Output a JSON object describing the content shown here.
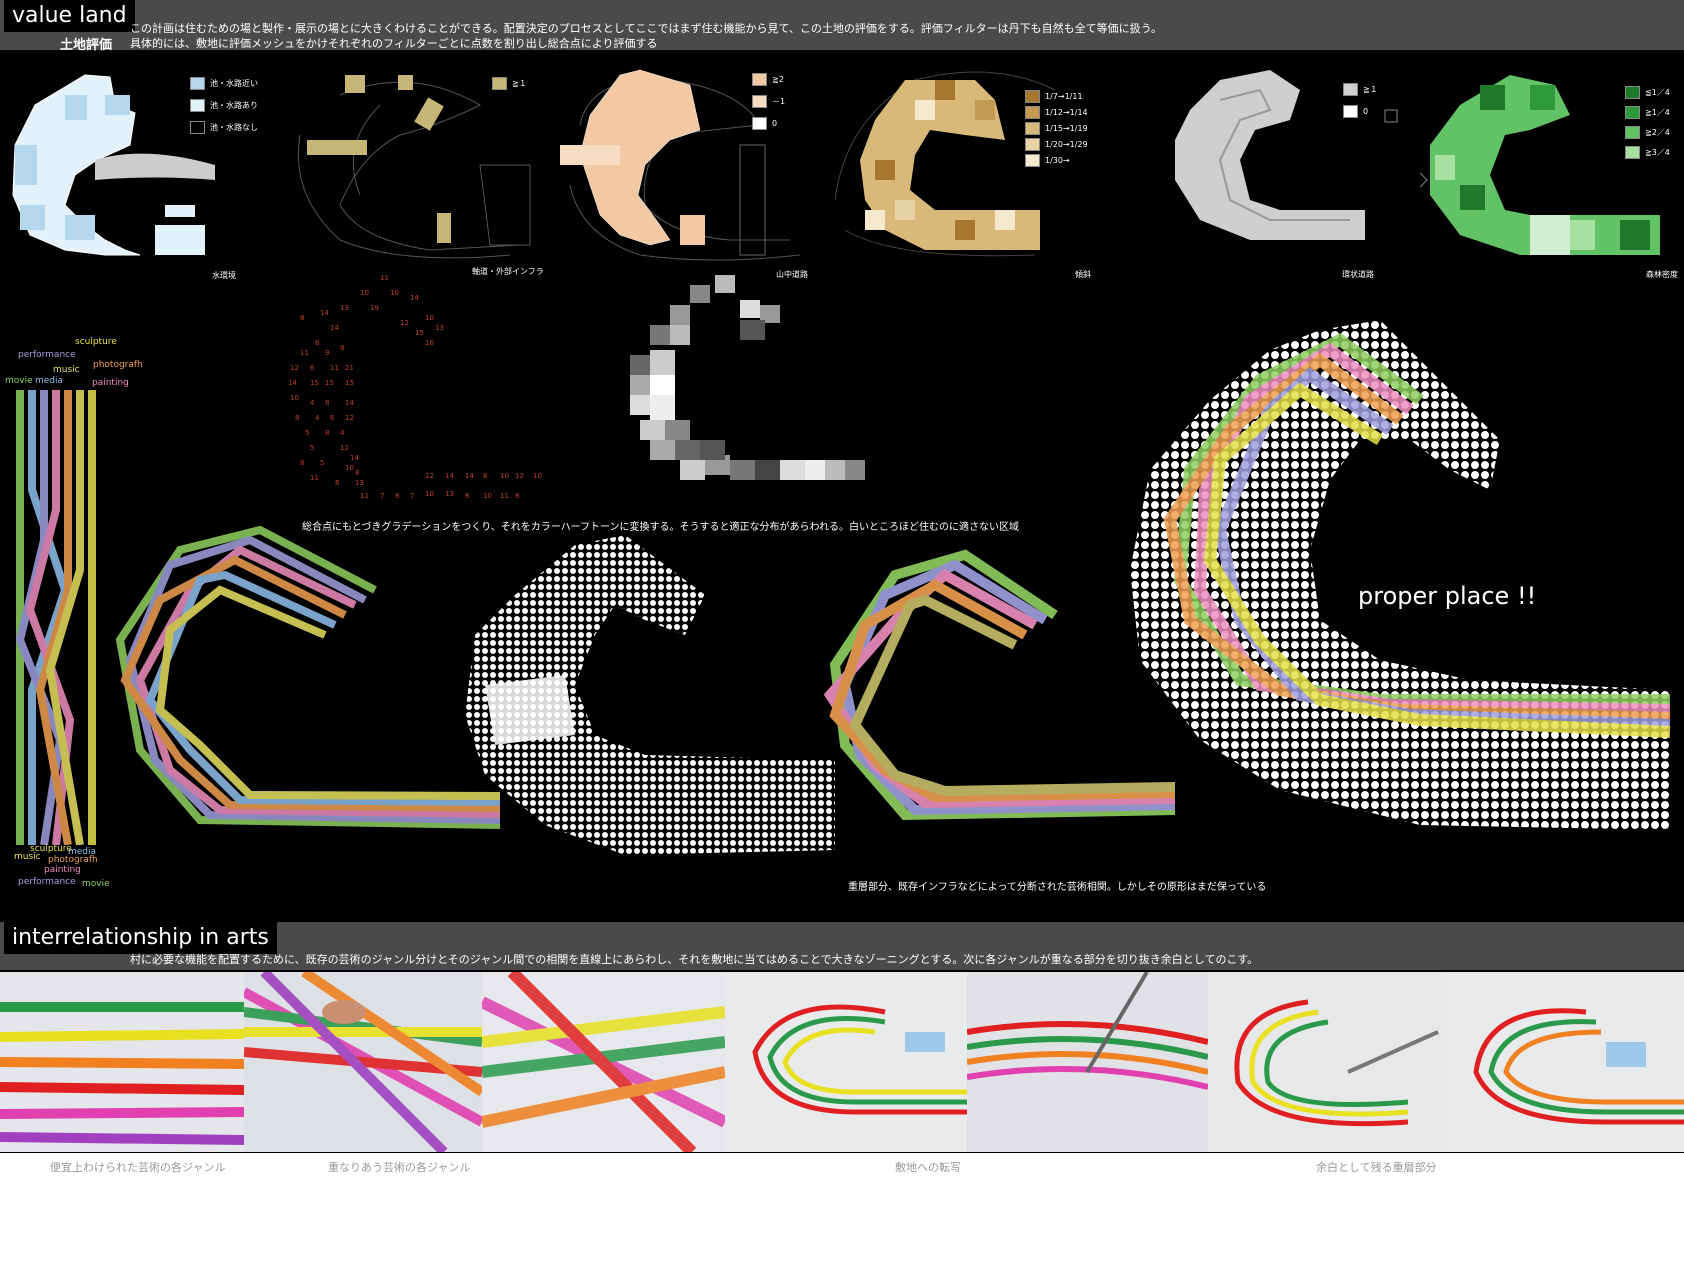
{
  "header": {
    "title": "value land",
    "subtitle": "土地評価",
    "desc1": "この計画は住むための場と製作・展示の場とに大きくわけることができる。配置決定のプロセスとしてここではまず住む機能から見て、この土地の評価をする。評価フィルターは丹下も自然も全て等価に扱う。",
    "desc2": "具体的には、敷地に評価メッシュをかけそれぞれのフィルターごとに点数を割り出し総合点により評価する"
  },
  "maps": [
    {
      "caption": "水環境",
      "legend": [
        {
          "label": "池・水路近い",
          "color": "#b6d8ef"
        },
        {
          "label": "池・水路あり",
          "color": "#e2f1fa"
        },
        {
          "label": "池・水路なし",
          "color": "#000000"
        }
      ]
    },
    {
      "caption": "軸道・外部インフラ",
      "legend": [
        {
          "label": "≧１",
          "color": "#c8b677"
        }
      ]
    },
    {
      "caption": "山中道路",
      "legend": [
        {
          "label": "≧2",
          "color": "#f2c9a2"
        },
        {
          "label": "－1",
          "color": "#f6dcc3"
        },
        {
          "label": "0",
          "color": "#ffffff"
        }
      ]
    },
    {
      "caption": "傾斜",
      "legend": [
        {
          "label": "1/7→1/11",
          "color": "#a8772f"
        },
        {
          "label": "1/12→1/14",
          "color": "#c49a53"
        },
        {
          "label": "1/15→1/19",
          "color": "#d9b97a"
        },
        {
          "label": "1/20→1/29",
          "color": "#e8d3a4"
        },
        {
          "label": "1/30→",
          "color": "#f5ead0"
        }
      ]
    },
    {
      "caption": "環状道路",
      "legend": [
        {
          "label": "≧１",
          "color": "#cfcfcf"
        },
        {
          "label": "0",
          "color": "#ffffff"
        }
      ]
    },
    {
      "caption": "森林密度",
      "legend": [
        {
          "label": "≦1／4",
          "color": "#1e7a2a"
        },
        {
          "label": "≧1／4",
          "color": "#2f9a3a"
        },
        {
          "label": "≧2／4",
          "color": "#62c266"
        },
        {
          "label": "≧3／4",
          "color": "#a8e0a2"
        }
      ]
    }
  ],
  "middle": {
    "gradation_desc": "総合点にもとづきグラデーションをつくり、それをカラーハーフトーンに変換する。そうすると適正な分布があらわれる。白いところほど住むのに適さない区域",
    "overlap_desc": "重層部分、既存インフラなどによって分断された芸術相関。しかしその原形はまだ保っている",
    "proper_place": "proper  place !!",
    "scores_row": [
      "12",
      "14",
      "14",
      "8",
      "10",
      "12",
      "10"
    ],
    "scores_row2": [
      "11",
      "9",
      "8",
      "13",
      "8",
      "10",
      "11",
      "8"
    ]
  },
  "genres_top": [
    {
      "label": "sculpture",
      "color": "#e6e04a"
    },
    {
      "label": "performance",
      "color": "#a0a0e0"
    },
    {
      "label": "music",
      "color": "#e8e060"
    },
    {
      "label": "photografh",
      "color": "#f0a050"
    },
    {
      "label": "movie",
      "color": "#8fd060"
    },
    {
      "label": "media",
      "color": "#90c0f0"
    },
    {
      "label": "painting",
      "color": "#f090c0"
    }
  ],
  "genres_bottom": [
    {
      "label": "sculpture",
      "color": "#e6e04a"
    },
    {
      "label": "media",
      "color": "#90c0f0"
    },
    {
      "label": "music",
      "color": "#e8e060"
    },
    {
      "label": "photografh",
      "color": "#f0a050"
    },
    {
      "label": "painting",
      "color": "#f090c0"
    },
    {
      "label": "performance",
      "color": "#a0a0e0"
    },
    {
      "label": "movie",
      "color": "#8fd060"
    }
  ],
  "section2": {
    "title": "interrelationship in arts",
    "desc": "村に必要な機能を配置するために、既存の芸術のジャンル分けとそのジャンル間での相関を直線上にあらわし、それを敷地に当てはめることで大きなゾーニングとする。次に各ジャンルが重なる部分を切り抜き余白としてのこす。"
  },
  "photo_captions": [
    "便宜上わけられた芸術の各ジャンル",
    "重なりあう芸術の各ジャンル",
    "敷地への転写",
    "余白として残る重層部分"
  ],
  "colors": {
    "bands": [
      "#8fd060",
      "#a0a0e0",
      "#f090c0",
      "#f0a050",
      "#90c0f0",
      "#e8e060"
    ]
  }
}
